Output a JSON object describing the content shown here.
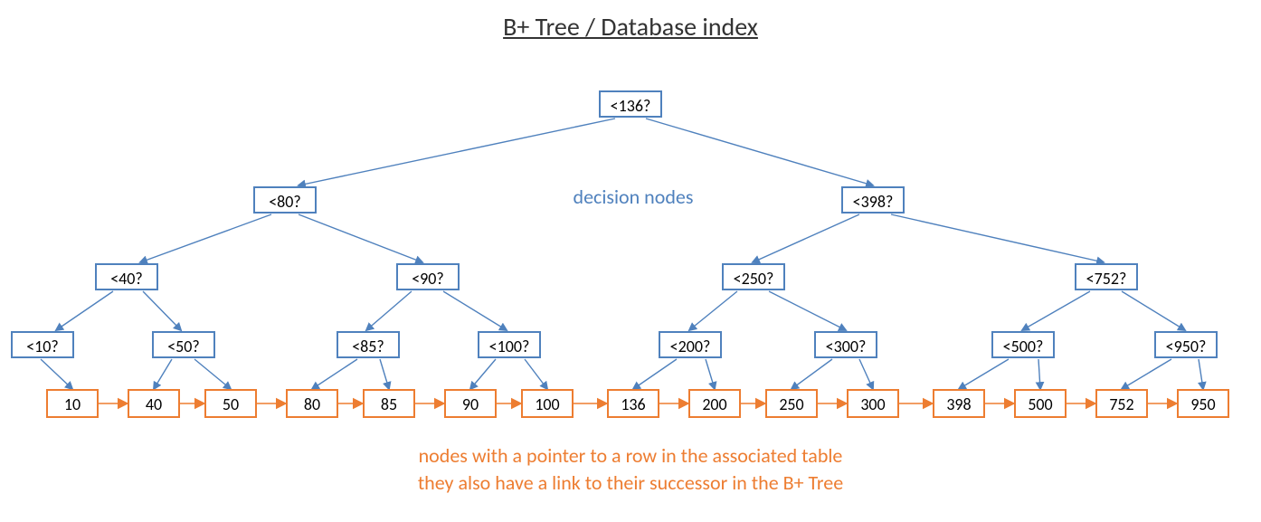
{
  "title": "B+ Tree / Database index",
  "labels": {
    "decision": "decision nodes",
    "footer1": "nodes with a pointer to a row in the associated table",
    "footer2": "they also have a link to their successor in the B+ Tree"
  },
  "d": {
    "root": "<136?",
    "l2a": "<80?",
    "l2b": "<398?",
    "l3a": "<40?",
    "l3b": "<90?",
    "l3c": "<250?",
    "l3d": "<752?",
    "l4a": "<10?",
    "l4b": "<50?",
    "l4c": "<85?",
    "l4d": "<100?",
    "l4e": "<200?",
    "l4f": "<300?",
    "l4g": "<500?",
    "l4h": "<950?"
  },
  "leaf": {
    "v0": "10",
    "v1": "40",
    "v2": "50",
    "v3": "80",
    "v4": "85",
    "v5": "90",
    "v6": "100",
    "v7": "136",
    "v8": "200",
    "v9": "250",
    "v10": "300",
    "v11": "398",
    "v12": "500",
    "v13": "752",
    "v14": "950"
  },
  "colors": {
    "blue": "#4f81bd",
    "orange": "#ed7d31"
  }
}
